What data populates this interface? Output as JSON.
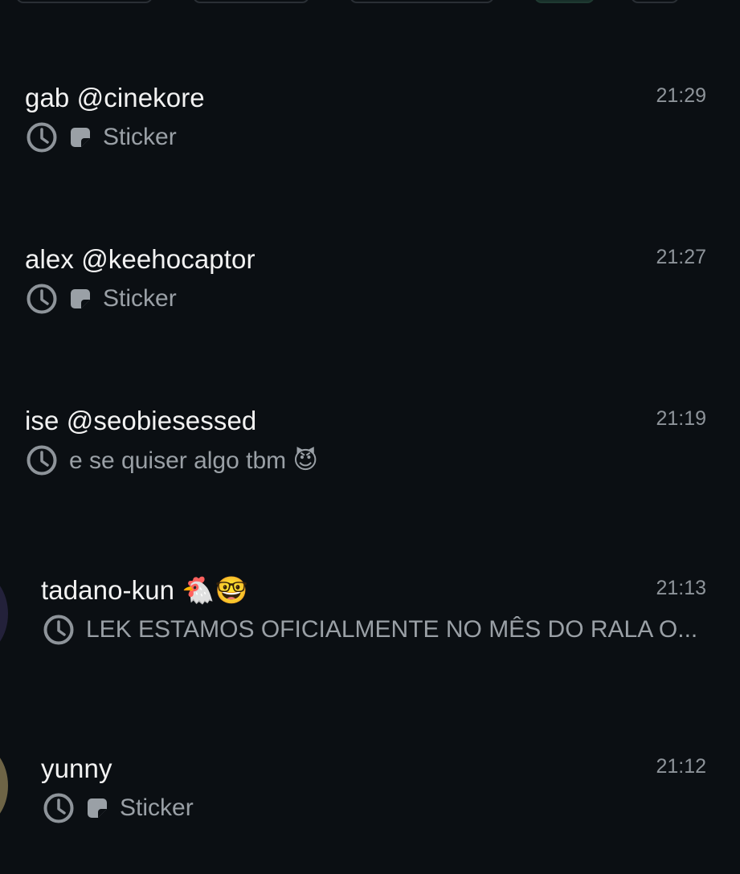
{
  "chats": [
    {
      "name": "gab @cinekore",
      "time": "21:29",
      "preview": "Sticker",
      "has_sticker_icon": true,
      "status_icon": "clock-icon"
    },
    {
      "name": "alex @keehocaptor",
      "time": "21:27",
      "preview": "Sticker",
      "has_sticker_icon": true,
      "status_icon": "clock-icon"
    },
    {
      "name": "ise @seobiesessed",
      "time": "21:19",
      "preview": "e se quiser algo tbm 😈",
      "has_sticker_icon": false,
      "status_icon": "clock-icon"
    },
    {
      "name": "tadano-kun 🐔🤓",
      "time": "21:13",
      "preview": "LEK ESTAMOS OFICIALMENTE NO MÊS DO RALA O...",
      "has_sticker_icon": false,
      "status_icon": "clock-icon"
    },
    {
      "name": "yunny",
      "time": "21:12",
      "preview": "Sticker",
      "has_sticker_icon": true,
      "status_icon": "clock-icon"
    }
  ],
  "colors": {
    "background": "#0b0f13",
    "name_text": "#f2f2f2",
    "secondary_text": "#9aa0a6",
    "time_text": "#8e949a"
  }
}
